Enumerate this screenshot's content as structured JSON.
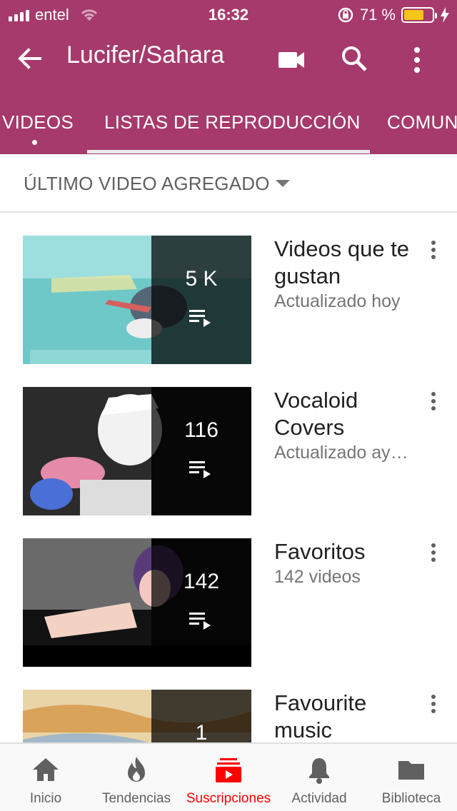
{
  "status_bar": {
    "carrier": "entel",
    "time": "16:32",
    "battery": "71 %",
    "battery_level": 0.71
  },
  "app_bar": {
    "title": "Lucifer/Sahara",
    "icons": [
      "back-arrow-icon",
      "video-camera-icon",
      "search-icon",
      "more-vertical-icon"
    ]
  },
  "tabs": [
    {
      "label": "VIDEOS",
      "has_new_dot": true
    },
    {
      "label": "LISTAS DE REPRODUCCIÓN",
      "selected": true
    },
    {
      "label": "COMUN"
    }
  ],
  "sort": {
    "label": "ÚLTIMO VIDEO AGREGADO"
  },
  "playlists": [
    {
      "title": "Videos que te gustan",
      "meta": "Actualizado hoy",
      "count": "5 K"
    },
    {
      "title": "Vocaloid Covers",
      "meta": "Actualizado ay…",
      "count": "116"
    },
    {
      "title": "Favoritos",
      "meta": "142 videos",
      "count": "142"
    },
    {
      "title": "Favourite music",
      "meta": "",
      "count": "1"
    }
  ],
  "bottom_nav": [
    {
      "label": "Inicio",
      "icon": "home-icon"
    },
    {
      "label": "Tendencias",
      "icon": "flame-icon"
    },
    {
      "label": "Suscripciones",
      "icon": "subscriptions-icon",
      "active": true
    },
    {
      "label": "Actividad",
      "icon": "bell-icon"
    },
    {
      "label": "Biblioteca",
      "icon": "folder-icon"
    }
  ],
  "colors": {
    "header": "#a63a6c",
    "accent_active": "#ff0000",
    "battery_fill": "#f5c518"
  }
}
